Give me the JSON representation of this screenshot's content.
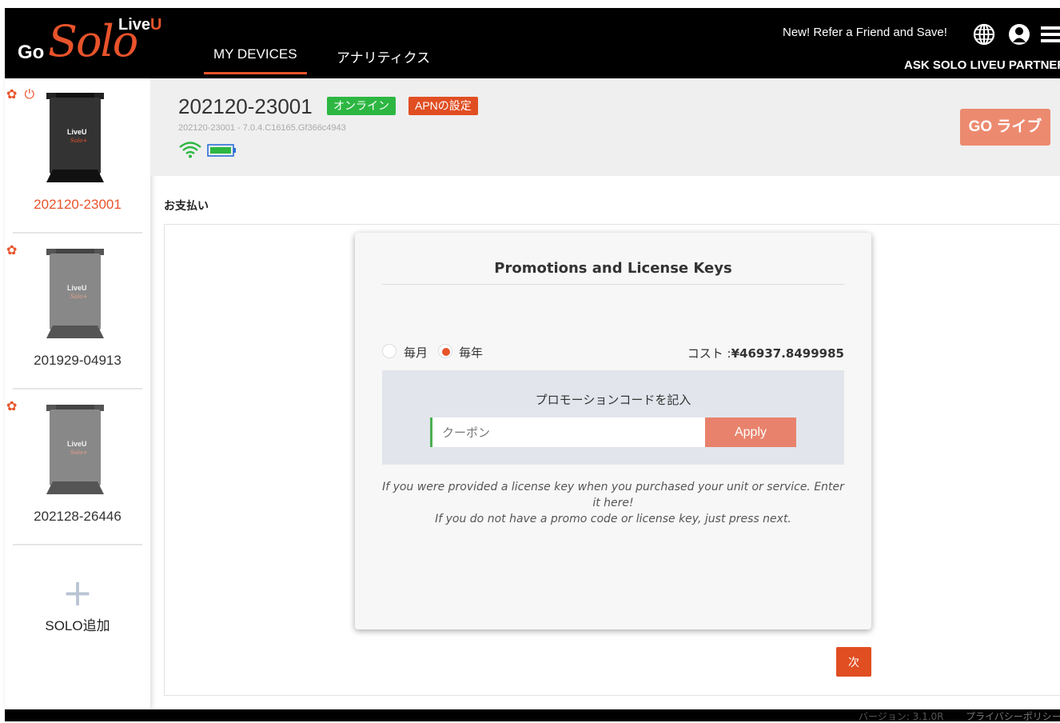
{
  "header": {
    "logo_go": "Go",
    "logo_solo": "Solo",
    "logo_live": "Live",
    "logo_u": "U",
    "tabs": [
      {
        "label": "MY DEVICES",
        "active": true
      },
      {
        "label": "アナリティクス",
        "active": false
      }
    ],
    "refer_text": "New! Refer a Friend and Save!",
    "partner_text": "ASK SOLO LIVEU PARTNER",
    "icons": [
      "globe-icon",
      "user-icon",
      "menu-icon"
    ]
  },
  "sidebar": {
    "devices": [
      {
        "label": "202120-23001",
        "active": true,
        "icons": [
          "gear-icon",
          "power-icon"
        ]
      },
      {
        "label": "201929-04913",
        "active": false,
        "icons": [
          "gear-icon"
        ]
      },
      {
        "label": "202128-26446",
        "active": false,
        "icons": [
          "gear-icon"
        ]
      }
    ],
    "add_label": "SOLO追加"
  },
  "device_header": {
    "name": "202120-23001",
    "status_badge": "オンライン",
    "apn_badge": "APNの設定",
    "firmware": "202120-23001 - 7.0.4.C16165.Gf366c4943",
    "go_live": "GO ライブ",
    "colors": {
      "online": "#2db742",
      "apn": "#e04e22",
      "accent": "#e8532b"
    }
  },
  "page": {
    "section_title": "お支払い"
  },
  "card": {
    "title": "Promotions and License Keys",
    "monthly_label": "毎月",
    "yearly_label": "毎年",
    "selected": "yearly",
    "cost_label": "コスト :",
    "cost_value": "¥46937.8499985",
    "promo_label": "プロモーションコードを記入",
    "coupon_placeholder": "クーポン",
    "coupon_value": "",
    "apply_label": "Apply",
    "note_line1": "If you were provided a license key when you purchased your unit or service. Enter it here!",
    "note_line2": "If you do not have a promo code or license key, just press next."
  },
  "next_label": "次",
  "footer": {
    "version": "バージョン: 3.1.0R",
    "privacy": "プライバシーポリシー"
  }
}
